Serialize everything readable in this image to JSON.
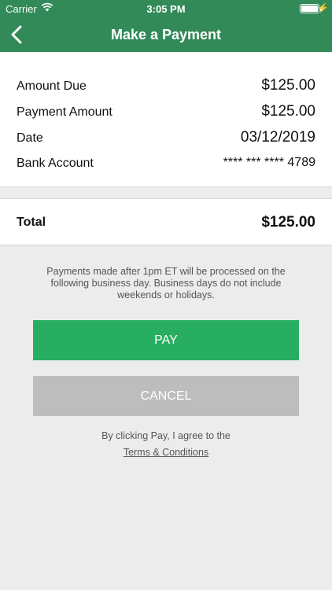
{
  "status_bar": {
    "carrier": "Carrier",
    "time": "3:05 PM",
    "bolt": "⚡"
  },
  "nav": {
    "title": "Make a Payment"
  },
  "details": {
    "amount_due_label": "Amount Due",
    "amount_due_value": "$125.00",
    "payment_amount_label": "Payment Amount",
    "payment_amount_value": "$125.00",
    "date_label": "Date",
    "date_value": "03/12/2019",
    "bank_label": "Bank Account",
    "bank_value": "**** *** **** 4789"
  },
  "total": {
    "label": "Total",
    "value": "$125.00"
  },
  "notice": "Payments made after 1pm ET will be processed on the following business day. Business days do not include weekends or holidays.",
  "buttons": {
    "pay": "PAY",
    "cancel": "CANCEL"
  },
  "agreement": {
    "text": "By clicking Pay, I agree to the",
    "terms_link": "Terms & Conditions"
  },
  "colors": {
    "header": "#318a58",
    "pay_button": "#27ae60",
    "cancel_button": "#bdbdbd",
    "background": "#ececec"
  },
  "icons": {
    "back": "chevron-left-icon",
    "wifi": "wifi-icon",
    "battery": "battery-icon"
  }
}
